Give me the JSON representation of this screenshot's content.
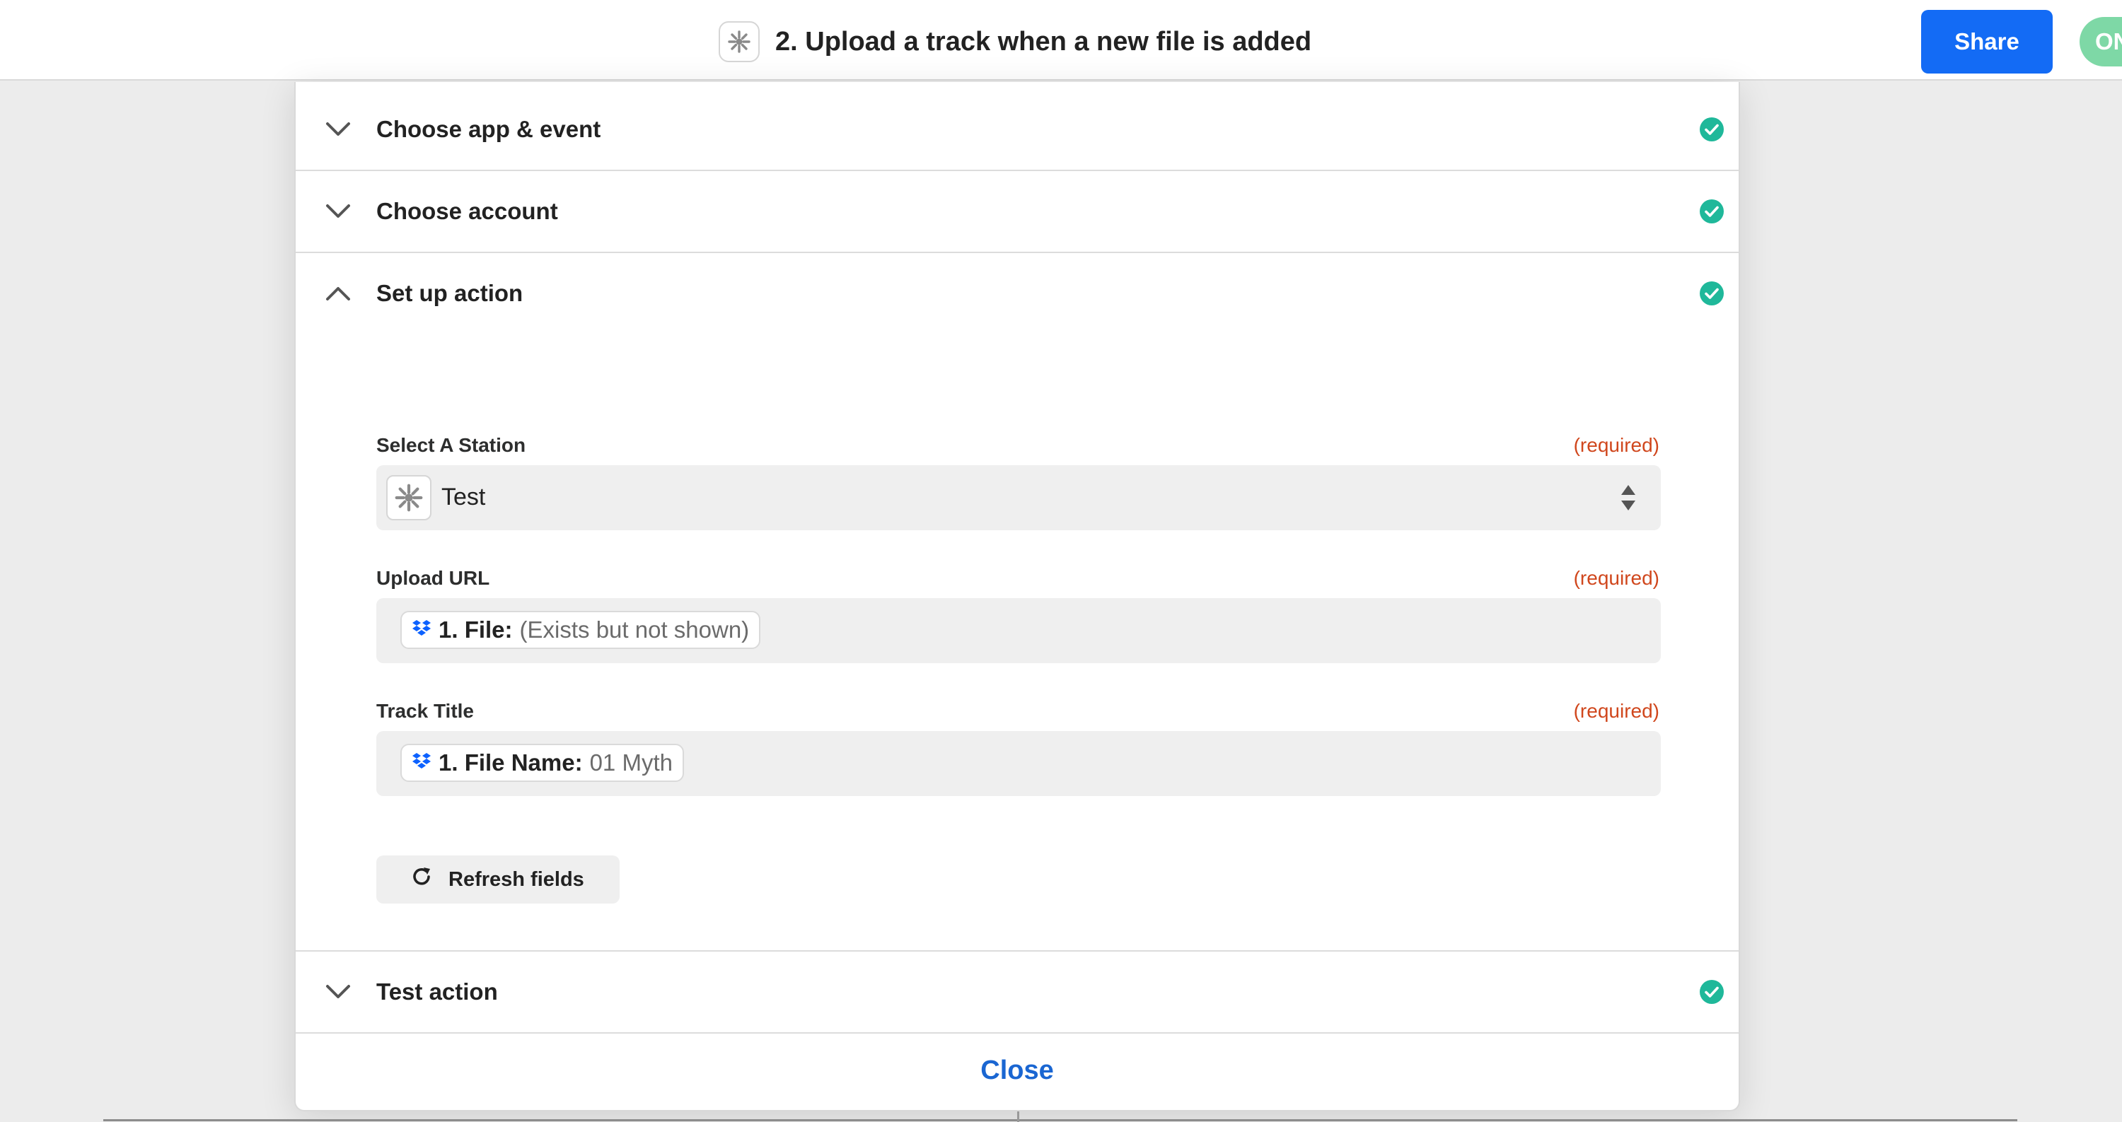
{
  "header": {
    "title": "2. Upload a track when a new file is added",
    "app_icon": "gear-cog-icon",
    "share_label": "Share",
    "toggle_label": "ON"
  },
  "sections": [
    {
      "title": "Choose app & event",
      "state": "collapsed",
      "status": "complete"
    },
    {
      "title": "Choose account",
      "state": "collapsed",
      "status": "complete"
    },
    {
      "title": "Set up action",
      "state": "expanded",
      "status": "complete"
    },
    {
      "title": "Test action",
      "state": "collapsed",
      "status": "complete"
    }
  ],
  "setup": {
    "station": {
      "label": "Select A Station",
      "required": "(required)",
      "value": "Test"
    },
    "upload_url": {
      "label": "Upload URL",
      "required": "(required)",
      "pill_key": "1. File:",
      "pill_value": "(Exists but not shown)",
      "pill_icon": "dropbox-icon"
    },
    "track_title": {
      "label": "Track Title",
      "required": "(required)",
      "pill_key": "1. File Name:",
      "pill_value": "01 Myth",
      "pill_icon": "dropbox-icon"
    },
    "refresh_label": "Refresh fields"
  },
  "footer": {
    "close_label": "Close"
  },
  "colors": {
    "accent": "#136bf5",
    "success": "#1fb89a",
    "required": "#d0471d",
    "link": "#1a66d2"
  }
}
